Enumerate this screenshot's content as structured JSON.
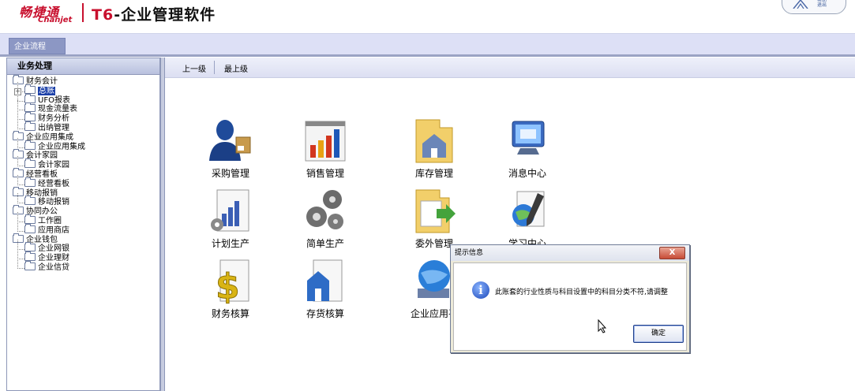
{
  "header": {
    "brand_cn": "畅捷通",
    "brand_en": "Chanjet",
    "product_prefix": "T6",
    "product_title": "-企业管理软件",
    "badge_text_1": "帮助",
    "badge_text_2": "退出"
  },
  "tabs": [
    {
      "label": "企业流程"
    }
  ],
  "sidebar": {
    "header": "业务处理",
    "tree": [
      {
        "label": "财务会计",
        "level": 0
      },
      {
        "label": "总账",
        "level": 1,
        "selected": true,
        "expandable": true
      },
      {
        "label": "UFO报表",
        "level": 1
      },
      {
        "label": "现金流量表",
        "level": 1
      },
      {
        "label": "财务分析",
        "level": 1
      },
      {
        "label": "出纳管理",
        "level": 1
      },
      {
        "label": "企业应用集成",
        "level": 0
      },
      {
        "label": "企业应用集成",
        "level": 1
      },
      {
        "label": "会计家园",
        "level": 0
      },
      {
        "label": "会计家园",
        "level": 1
      },
      {
        "label": "经营看板",
        "level": 0
      },
      {
        "label": "经营看板",
        "level": 1
      },
      {
        "label": "移动报销",
        "level": 0
      },
      {
        "label": "移动报销",
        "level": 1
      },
      {
        "label": "协同办公",
        "level": 0
      },
      {
        "label": "工作圈",
        "level": 1
      },
      {
        "label": "应用商店",
        "level": 1
      },
      {
        "label": "企业钱包",
        "level": 0
      },
      {
        "label": "企业网银",
        "level": 1
      },
      {
        "label": "企业理财",
        "level": 1
      },
      {
        "label": "企业信贷",
        "level": 1
      }
    ]
  },
  "toolbar": {
    "up_one": "上一级",
    "top_level": "最上级"
  },
  "apps": [
    {
      "label": "采购管理",
      "icon": "purchase-person-icon"
    },
    {
      "label": "销售管理",
      "icon": "bar-chart-icon"
    },
    {
      "label": "库存管理",
      "icon": "warehouse-folder-icon"
    },
    {
      "label": "消息中心",
      "icon": "monitor-icon"
    },
    {
      "label": "计划生产",
      "icon": "planning-chart-icon"
    },
    {
      "label": "简单生产",
      "icon": "gears-icon"
    },
    {
      "label": "委外管理",
      "icon": "outsource-folder-icon"
    },
    {
      "label": "学习中心",
      "icon": "globe-pen-icon"
    },
    {
      "label": "财务核算",
      "icon": "dollar-doc-icon"
    },
    {
      "label": "存货核算",
      "icon": "inventory-doc-icon"
    },
    {
      "label": "企业应用平",
      "icon": "globe-server-icon"
    }
  ],
  "dialog": {
    "title": "提示信息",
    "close": "X",
    "message": "此账套的行业性质与科目设置中的科目分类不符,请调整",
    "ok": "确定"
  }
}
